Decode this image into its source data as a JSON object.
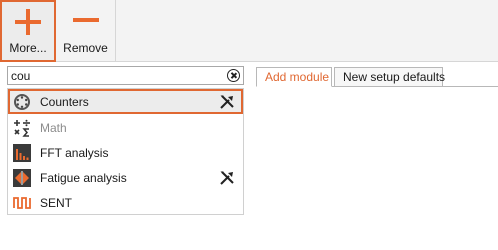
{
  "toolbar": {
    "more_label": "More...",
    "remove_label": "Remove"
  },
  "search": {
    "value": "cou"
  },
  "modules": [
    {
      "label": "Counters",
      "icon": "counters-icon",
      "has_tool": true,
      "selected": true,
      "enabled": true
    },
    {
      "label": "Math",
      "icon": "math-icon",
      "has_tool": false,
      "selected": false,
      "enabled": false
    },
    {
      "label": "FFT analysis",
      "icon": "fft-icon",
      "has_tool": false,
      "selected": false,
      "enabled": true
    },
    {
      "label": "Fatigue analysis",
      "icon": "fatigue-icon",
      "has_tool": true,
      "selected": false,
      "enabled": true
    },
    {
      "label": "SENT",
      "icon": "sent-icon",
      "has_tool": false,
      "selected": false,
      "enabled": true
    }
  ],
  "tabs": [
    {
      "label": "Add module",
      "active": true
    },
    {
      "label": "New setup defaults",
      "active": false
    }
  ],
  "colors": {
    "accent": "#e06832",
    "highlight": "#ececec",
    "disabled_text": "#8c8c8c"
  }
}
